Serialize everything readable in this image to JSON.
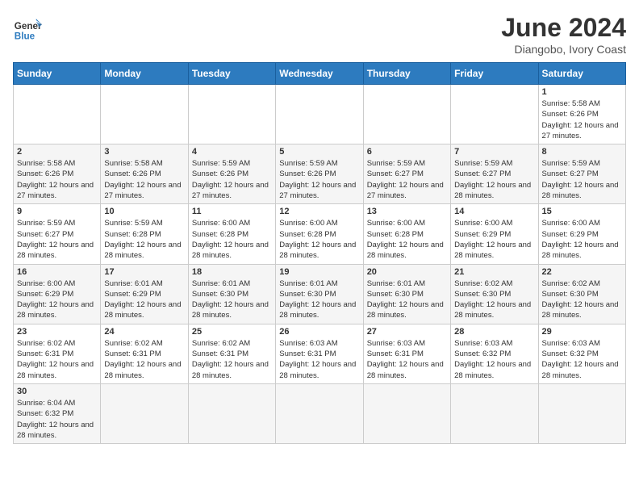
{
  "header": {
    "logo_general": "General",
    "logo_blue": "Blue",
    "title": "June 2024",
    "subtitle": "Diangobo, Ivory Coast"
  },
  "weekdays": [
    "Sunday",
    "Monday",
    "Tuesday",
    "Wednesday",
    "Thursday",
    "Friday",
    "Saturday"
  ],
  "weeks": [
    [
      {
        "day": "",
        "info": ""
      },
      {
        "day": "",
        "info": ""
      },
      {
        "day": "",
        "info": ""
      },
      {
        "day": "",
        "info": ""
      },
      {
        "day": "",
        "info": ""
      },
      {
        "day": "",
        "info": ""
      },
      {
        "day": "1",
        "info": "Sunrise: 5:58 AM\nSunset: 6:26 PM\nDaylight: 12 hours and 27 minutes."
      }
    ],
    [
      {
        "day": "2",
        "info": "Sunrise: 5:58 AM\nSunset: 6:26 PM\nDaylight: 12 hours and 27 minutes."
      },
      {
        "day": "3",
        "info": "Sunrise: 5:58 AM\nSunset: 6:26 PM\nDaylight: 12 hours and 27 minutes."
      },
      {
        "day": "4",
        "info": "Sunrise: 5:59 AM\nSunset: 6:26 PM\nDaylight: 12 hours and 27 minutes."
      },
      {
        "day": "5",
        "info": "Sunrise: 5:59 AM\nSunset: 6:26 PM\nDaylight: 12 hours and 27 minutes."
      },
      {
        "day": "6",
        "info": "Sunrise: 5:59 AM\nSunset: 6:27 PM\nDaylight: 12 hours and 27 minutes."
      },
      {
        "day": "7",
        "info": "Sunrise: 5:59 AM\nSunset: 6:27 PM\nDaylight: 12 hours and 28 minutes."
      },
      {
        "day": "8",
        "info": "Sunrise: 5:59 AM\nSunset: 6:27 PM\nDaylight: 12 hours and 28 minutes."
      }
    ],
    [
      {
        "day": "9",
        "info": "Sunrise: 5:59 AM\nSunset: 6:27 PM\nDaylight: 12 hours and 28 minutes."
      },
      {
        "day": "10",
        "info": "Sunrise: 5:59 AM\nSunset: 6:28 PM\nDaylight: 12 hours and 28 minutes."
      },
      {
        "day": "11",
        "info": "Sunrise: 6:00 AM\nSunset: 6:28 PM\nDaylight: 12 hours and 28 minutes."
      },
      {
        "day": "12",
        "info": "Sunrise: 6:00 AM\nSunset: 6:28 PM\nDaylight: 12 hours and 28 minutes."
      },
      {
        "day": "13",
        "info": "Sunrise: 6:00 AM\nSunset: 6:28 PM\nDaylight: 12 hours and 28 minutes."
      },
      {
        "day": "14",
        "info": "Sunrise: 6:00 AM\nSunset: 6:29 PM\nDaylight: 12 hours and 28 minutes."
      },
      {
        "day": "15",
        "info": "Sunrise: 6:00 AM\nSunset: 6:29 PM\nDaylight: 12 hours and 28 minutes."
      }
    ],
    [
      {
        "day": "16",
        "info": "Sunrise: 6:00 AM\nSunset: 6:29 PM\nDaylight: 12 hours and 28 minutes."
      },
      {
        "day": "17",
        "info": "Sunrise: 6:01 AM\nSunset: 6:29 PM\nDaylight: 12 hours and 28 minutes."
      },
      {
        "day": "18",
        "info": "Sunrise: 6:01 AM\nSunset: 6:30 PM\nDaylight: 12 hours and 28 minutes."
      },
      {
        "day": "19",
        "info": "Sunrise: 6:01 AM\nSunset: 6:30 PM\nDaylight: 12 hours and 28 minutes."
      },
      {
        "day": "20",
        "info": "Sunrise: 6:01 AM\nSunset: 6:30 PM\nDaylight: 12 hours and 28 minutes."
      },
      {
        "day": "21",
        "info": "Sunrise: 6:02 AM\nSunset: 6:30 PM\nDaylight: 12 hours and 28 minutes."
      },
      {
        "day": "22",
        "info": "Sunrise: 6:02 AM\nSunset: 6:30 PM\nDaylight: 12 hours and 28 minutes."
      }
    ],
    [
      {
        "day": "23",
        "info": "Sunrise: 6:02 AM\nSunset: 6:31 PM\nDaylight: 12 hours and 28 minutes."
      },
      {
        "day": "24",
        "info": "Sunrise: 6:02 AM\nSunset: 6:31 PM\nDaylight: 12 hours and 28 minutes."
      },
      {
        "day": "25",
        "info": "Sunrise: 6:02 AM\nSunset: 6:31 PM\nDaylight: 12 hours and 28 minutes."
      },
      {
        "day": "26",
        "info": "Sunrise: 6:03 AM\nSunset: 6:31 PM\nDaylight: 12 hours and 28 minutes."
      },
      {
        "day": "27",
        "info": "Sunrise: 6:03 AM\nSunset: 6:31 PM\nDaylight: 12 hours and 28 minutes."
      },
      {
        "day": "28",
        "info": "Sunrise: 6:03 AM\nSunset: 6:32 PM\nDaylight: 12 hours and 28 minutes."
      },
      {
        "day": "29",
        "info": "Sunrise: 6:03 AM\nSunset: 6:32 PM\nDaylight: 12 hours and 28 minutes."
      }
    ],
    [
      {
        "day": "30",
        "info": "Sunrise: 6:04 AM\nSunset: 6:32 PM\nDaylight: 12 hours and 28 minutes."
      },
      {
        "day": "",
        "info": ""
      },
      {
        "day": "",
        "info": ""
      },
      {
        "day": "",
        "info": ""
      },
      {
        "day": "",
        "info": ""
      },
      {
        "day": "",
        "info": ""
      },
      {
        "day": "",
        "info": ""
      }
    ]
  ]
}
